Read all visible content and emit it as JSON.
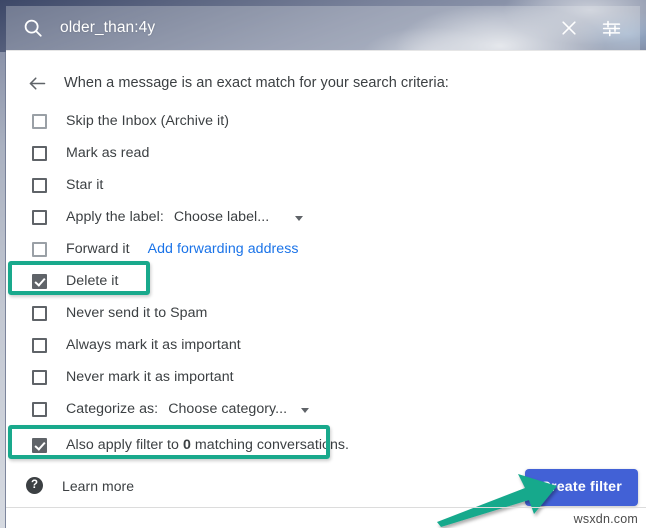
{
  "search": {
    "query": "older_than:4y",
    "search_icon": "search-icon",
    "close_icon": "close-icon",
    "options_icon": "filter-options-icon"
  },
  "header": {
    "back_icon": "back-arrow-icon",
    "title": "When a message is an exact match for your search criteria:"
  },
  "options": [
    {
      "label": "Skip the Inbox (Archive it)",
      "checked": false,
      "style": "light"
    },
    {
      "label": "Mark as read",
      "checked": false
    },
    {
      "label": "Star it",
      "checked": false
    },
    {
      "label": "Apply the label:",
      "checked": false,
      "select": "Choose label..."
    },
    {
      "label": "Forward it",
      "checked": false,
      "link": "Add forwarding address"
    },
    {
      "label": "Delete it",
      "checked": true,
      "highlighted": true
    },
    {
      "label": "Never send it to Spam",
      "checked": false
    },
    {
      "label": "Always mark it as important",
      "checked": false
    },
    {
      "label": "Never mark it as important",
      "checked": false
    },
    {
      "label": "Categorize as:",
      "checked": false,
      "select": "Choose category..."
    }
  ],
  "also_apply": {
    "checked": true,
    "prefix": "Also apply filter to ",
    "count": "0",
    "suffix": " matching conversations.",
    "highlighted": true
  },
  "footer": {
    "help_icon": "help-question-icon",
    "learn_more": "Learn more",
    "create_button": "Create filter"
  },
  "annotations": {
    "arrow": "pointer-arrow-icon",
    "highlight_color": "#19a98c"
  },
  "watermark": "wsxdn.com",
  "colors": {
    "accent_blue": "#4261d6",
    "link_blue": "#1a73e8",
    "highlight_teal": "#19a98c",
    "checkbox_fill": "#5f6368",
    "text": "#3c4043"
  }
}
